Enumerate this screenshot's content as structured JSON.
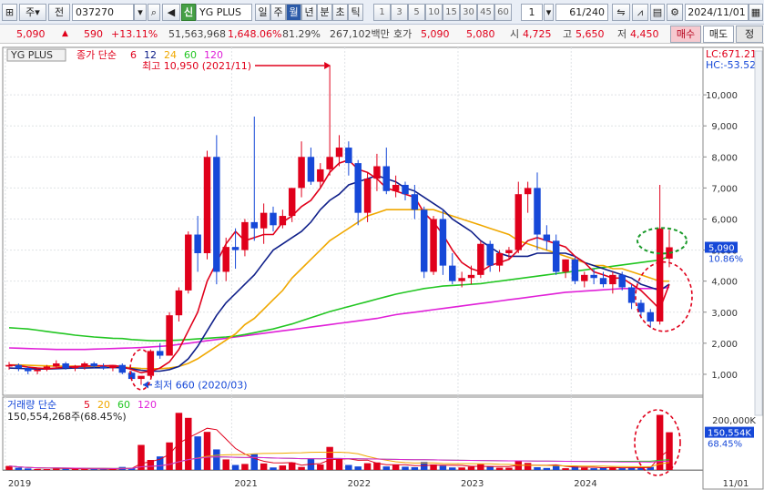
{
  "toolbar": {
    "menu1": "주",
    "menu2": "전",
    "code": "037270",
    "shin": "신",
    "name": "YG PLUS",
    "periods": [
      "일",
      "주",
      "월",
      "년",
      "분",
      "초",
      "틱"
    ],
    "active_period": "월",
    "numbers": [
      "1",
      "3",
      "5",
      "10",
      "15",
      "30",
      "45",
      "60"
    ],
    "spin_value": "1",
    "count": "61/240",
    "date": "2024/11/01"
  },
  "quote": {
    "price": "5,090",
    "change": "590",
    "pct": "+13.11%",
    "volume": "51,563,968",
    "vol_pct": "1,648.06%",
    "turnover": "81.29%",
    "amount": "267,102백만",
    "hoga_label": "호가",
    "ask": "5,090",
    "bid": "5,080",
    "open_label": "시",
    "open": "4,725",
    "high_label": "고",
    "high": "5,650",
    "low_label": "저",
    "low": "4,450",
    "buy_label": "매수",
    "sell_label": "매도",
    "other_label": "정"
  },
  "legend": {
    "name": "YG PLUS",
    "price_label": "종가 단순",
    "ma": [
      "6",
      "12",
      "24",
      "60",
      "120"
    ],
    "vol_label": "거래량 단순",
    "vol_ma": [
      "5",
      "20",
      "60",
      "120"
    ],
    "vol_value": "150,554,268주(68.45%)"
  },
  "annotations": {
    "high": "최고 10,950 (2021/11)",
    "low": "최저 660 (2020/03)",
    "lc": "LC:671.21",
    "hc": "HC:-53.52"
  },
  "axis": {
    "price_ticks": [
      "10,000",
      "9,000",
      "8,000",
      "7,000",
      "6,000",
      "5,000",
      "4,000",
      "3,000",
      "2,000",
      "1,000"
    ],
    "vol_tick": "200,000K",
    "price_box": "5,090",
    "price_box_pct": "10.86%",
    "vol_box": "150,554K",
    "vol_box_pct": "68.45%",
    "years": [
      "2019",
      "2021",
      "2022",
      "2023",
      "2024"
    ],
    "last_date": "11/01"
  },
  "colors": {
    "up": "#e0001b",
    "down": "#1648d8",
    "ma6": "#e0001b",
    "ma12": "#10208a",
    "ma24": "#f0a800",
    "ma60": "#22c622",
    "ma120": "#e020d8"
  },
  "chart_data": {
    "type": "candlestick",
    "period": "monthly",
    "ylim": [
      500,
      11000
    ],
    "months": [
      "2019-01",
      "2019-02",
      "2019-03",
      "2019-04",
      "2019-05",
      "2019-06",
      "2019-07",
      "2019-08",
      "2019-09",
      "2019-10",
      "2019-11",
      "2019-12",
      "2020-01",
      "2020-02",
      "2020-03",
      "2020-04",
      "2020-05",
      "2020-06",
      "2020-07",
      "2020-08",
      "2020-09",
      "2020-10",
      "2020-11",
      "2020-12",
      "2021-01",
      "2021-02",
      "2021-03",
      "2021-04",
      "2021-05",
      "2021-06",
      "2021-07",
      "2021-08",
      "2021-09",
      "2021-10",
      "2021-11",
      "2021-12",
      "2022-01",
      "2022-02",
      "2022-03",
      "2022-04",
      "2022-05",
      "2022-06",
      "2022-07",
      "2022-08",
      "2022-09",
      "2022-10",
      "2022-11",
      "2022-12",
      "2023-01",
      "2023-02",
      "2023-03",
      "2023-04",
      "2023-05",
      "2023-06",
      "2023-07",
      "2023-08",
      "2023-09",
      "2023-10",
      "2023-11",
      "2023-12",
      "2024-01",
      "2024-02",
      "2024-03",
      "2024-04",
      "2024-05",
      "2024-06",
      "2024-07",
      "2024-08",
      "2024-09",
      "2024-10",
      "2024-11"
    ],
    "ohlc": [
      [
        1250,
        1400,
        1150,
        1300
      ],
      [
        1300,
        1350,
        1100,
        1200
      ],
      [
        1200,
        1250,
        1000,
        1100
      ],
      [
        1100,
        1200,
        1000,
        1150
      ],
      [
        1150,
        1300,
        1100,
        1250
      ],
      [
        1250,
        1450,
        1200,
        1350
      ],
      [
        1350,
        1400,
        1150,
        1200
      ],
      [
        1200,
        1300,
        1100,
        1250
      ],
      [
        1250,
        1400,
        1150,
        1350
      ],
      [
        1350,
        1400,
        1200,
        1250
      ],
      [
        1250,
        1350,
        1150,
        1200
      ],
      [
        1200,
        1300,
        1100,
        1300
      ],
      [
        1300,
        1350,
        1000,
        1050
      ],
      [
        1050,
        1100,
        800,
        850
      ],
      [
        850,
        900,
        660,
        950
      ],
      [
        950,
        1800,
        900,
        1750
      ],
      [
        1750,
        2000,
        1500,
        1600
      ],
      [
        1600,
        3000,
        1600,
        2900
      ],
      [
        2900,
        3800,
        2700,
        3700
      ],
      [
        3700,
        5600,
        3600,
        5500
      ],
      [
        5500,
        6100,
        4300,
        4900
      ],
      [
        4900,
        8200,
        4700,
        8000
      ],
      [
        8000,
        8700,
        3900,
        4300
      ],
      [
        4300,
        5400,
        4000,
        5100
      ],
      [
        5100,
        5700,
        4400,
        5000
      ],
      [
        5000,
        6000,
        4800,
        5900
      ],
      [
        5900,
        9300,
        5300,
        5700
      ],
      [
        5700,
        6500,
        5200,
        6200
      ],
      [
        6200,
        6400,
        5600,
        5800
      ],
      [
        5800,
        6300,
        5700,
        6100
      ],
      [
        6100,
        7000,
        5900,
        7000
      ],
      [
        7000,
        8500,
        6700,
        8000
      ],
      [
        8000,
        8300,
        7100,
        7200
      ],
      [
        7200,
        7800,
        7000,
        7600
      ],
      [
        7600,
        10950,
        7400,
        8000
      ],
      [
        8000,
        8700,
        7700,
        8300
      ],
      [
        8300,
        8500,
        7400,
        7800
      ],
      [
        7800,
        7900,
        5800,
        6200
      ],
      [
        6200,
        7500,
        5900,
        7300
      ],
      [
        7300,
        8100,
        6900,
        7700
      ],
      [
        7700,
        8300,
        6800,
        6900
      ],
      [
        6900,
        7400,
        6700,
        7100
      ],
      [
        7100,
        7200,
        6600,
        6800
      ],
      [
        6800,
        7100,
        6000,
        6300
      ],
      [
        6300,
        6400,
        4100,
        4300
      ],
      [
        4300,
        6100,
        4200,
        6000
      ],
      [
        6000,
        6300,
        4200,
        4500
      ],
      [
        4500,
        4900,
        3900,
        4000
      ],
      [
        4000,
        4300,
        3800,
        4100
      ],
      [
        4100,
        4500,
        3900,
        4200
      ],
      [
        4200,
        5300,
        4100,
        5200
      ],
      [
        5200,
        5300,
        4300,
        4500
      ],
      [
        4500,
        5000,
        4300,
        4900
      ],
      [
        4900,
        5100,
        4700,
        5000
      ],
      [
        5000,
        7200,
        4900,
        6800
      ],
      [
        6800,
        7200,
        6200,
        7000
      ],
      [
        7000,
        7500,
        5000,
        5500
      ],
      [
        5500,
        5800,
        5000,
        5300
      ],
      [
        5300,
        5500,
        4200,
        4300
      ],
      [
        4300,
        4700,
        4100,
        4700
      ],
      [
        4700,
        4800,
        3900,
        4000
      ],
      [
        4000,
        4300,
        3800,
        4200
      ],
      [
        4200,
        4400,
        3900,
        4100
      ],
      [
        4100,
        4300,
        3800,
        3900
      ],
      [
        3900,
        4300,
        3600,
        4200
      ],
      [
        4200,
        4300,
        3700,
        3800
      ],
      [
        3800,
        3900,
        3100,
        3300
      ],
      [
        3300,
        3400,
        2800,
        3000
      ],
      [
        3000,
        3100,
        2500,
        2700
      ],
      [
        2700,
        7100,
        2600,
        5700
      ],
      [
        4725,
        5650,
        4450,
        5090
      ]
    ],
    "volume_k": [
      16000,
      9000,
      6000,
      4000,
      3500,
      9000,
      6000,
      4000,
      3500,
      3500,
      3000,
      4000,
      12000,
      9000,
      100000,
      40000,
      54000,
      110000,
      228000,
      208000,
      134000,
      152000,
      82000,
      42000,
      20000,
      24000,
      63000,
      26000,
      10000,
      18000,
      30000,
      12000,
      46000,
      22000,
      92000,
      44000,
      20000,
      14000,
      27000,
      30000,
      14000,
      20000,
      13000,
      11000,
      32000,
      22000,
      17000,
      10000,
      10000,
      13000,
      23000,
      14000,
      9000,
      9000,
      37000,
      28000,
      11000,
      8000,
      18000,
      7000,
      14000,
      9000,
      7000,
      9000,
      11000,
      7000,
      10000,
      9000,
      12000,
      220000,
      150554
    ],
    "moving_averages": {
      "ma6": [
        1300,
        1280,
        1230,
        1200,
        1180,
        1200,
        1230,
        1250,
        1260,
        1280,
        1270,
        1280,
        1250,
        1150,
        1050,
        1100,
        1200,
        1400,
        1800,
        2400,
        3000,
        4000,
        4600,
        5200,
        5600,
        5300,
        5400,
        5500,
        5500,
        5900,
        6100,
        6400,
        6600,
        7000,
        7500,
        7800,
        7900,
        7600,
        7500,
        7300,
        7000,
        6900,
        6800,
        6700,
        6200,
        5900,
        5500,
        5000,
        4600,
        4400,
        4300,
        4500,
        4600,
        4700,
        5000,
        5300,
        5400,
        5300,
        5200,
        5100,
        4800,
        4600,
        4300,
        4200,
        4100,
        4100,
        3900,
        3700,
        3400,
        3100,
        3900
      ],
      "ma12": [
        1200,
        1190,
        1180,
        1170,
        1170,
        1180,
        1190,
        1200,
        1200,
        1210,
        1210,
        1220,
        1210,
        1180,
        1130,
        1100,
        1100,
        1150,
        1250,
        1500,
        1900,
        2400,
        2900,
        3300,
        3600,
        3900,
        4200,
        4600,
        5000,
        5200,
        5400,
        5600,
        5900,
        6300,
        6600,
        6800,
        7100,
        7200,
        7300,
        7400,
        7300,
        7200,
        7000,
        6900,
        6700,
        6500,
        6300,
        6000,
        5800,
        5600,
        5300,
        5100,
        4900,
        4800,
        4800,
        4800,
        4900,
        4900,
        4900,
        4900,
        4800,
        4600,
        4500,
        4400,
        4300,
        4200,
        4100,
        3900,
        3800,
        3700,
        3900
      ],
      "ma24": [
        1300,
        1300,
        1290,
        1280,
        1270,
        1260,
        1260,
        1260,
        1250,
        1250,
        1250,
        1240,
        1230,
        1210,
        1190,
        1180,
        1180,
        1200,
        1250,
        1350,
        1500,
        1700,
        1900,
        2100,
        2300,
        2600,
        2800,
        3100,
        3400,
        3700,
        4100,
        4400,
        4700,
        5000,
        5300,
        5500,
        5700,
        5900,
        6100,
        6200,
        6300,
        6300,
        6300,
        6300,
        6300,
        6300,
        6200,
        6100,
        6000,
        5900,
        5800,
        5700,
        5600,
        5500,
        5300,
        5200,
        5100,
        5000,
        4900,
        4800,
        4700,
        4600,
        4500,
        4500,
        4400,
        4400,
        4300,
        4200,
        4100,
        4000,
        4000
      ],
      "ma60": [
        2500,
        2480,
        2460,
        2420,
        2380,
        2340,
        2300,
        2260,
        2230,
        2200,
        2180,
        2160,
        2150,
        2120,
        2100,
        2080,
        2080,
        2090,
        2100,
        2120,
        2140,
        2160,
        2180,
        2200,
        2230,
        2280,
        2340,
        2400,
        2460,
        2540,
        2620,
        2720,
        2820,
        2920,
        3020,
        3100,
        3180,
        3260,
        3340,
        3420,
        3500,
        3580,
        3640,
        3700,
        3760,
        3800,
        3840,
        3860,
        3880,
        3900,
        3920,
        3960,
        4000,
        4040,
        4080,
        4120,
        4160,
        4200,
        4240,
        4280,
        4320,
        4360,
        4400,
        4440,
        4480,
        4520,
        4560,
        4600,
        4640,
        4680,
        4800
      ],
      "ma120": [
        1850,
        1840,
        1830,
        1820,
        1810,
        1800,
        1800,
        1800,
        1800,
        1810,
        1820,
        1830,
        1840,
        1850,
        1860,
        1880,
        1900,
        1920,
        1960,
        2000,
        2040,
        2080,
        2120,
        2160,
        2200,
        2240,
        2280,
        2320,
        2360,
        2400,
        2440,
        2480,
        2520,
        2560,
        2600,
        2640,
        2680,
        2720,
        2760,
        2800,
        2860,
        2920,
        2960,
        3000,
        3040,
        3080,
        3120,
        3160,
        3200,
        3240,
        3280,
        3320,
        3360,
        3400,
        3440,
        3480,
        3520,
        3560,
        3600,
        3640,
        3660,
        3680,
        3700,
        3720,
        3740,
        3760,
        3760,
        3760,
        3760,
        3760,
        3800
      ]
    }
  }
}
